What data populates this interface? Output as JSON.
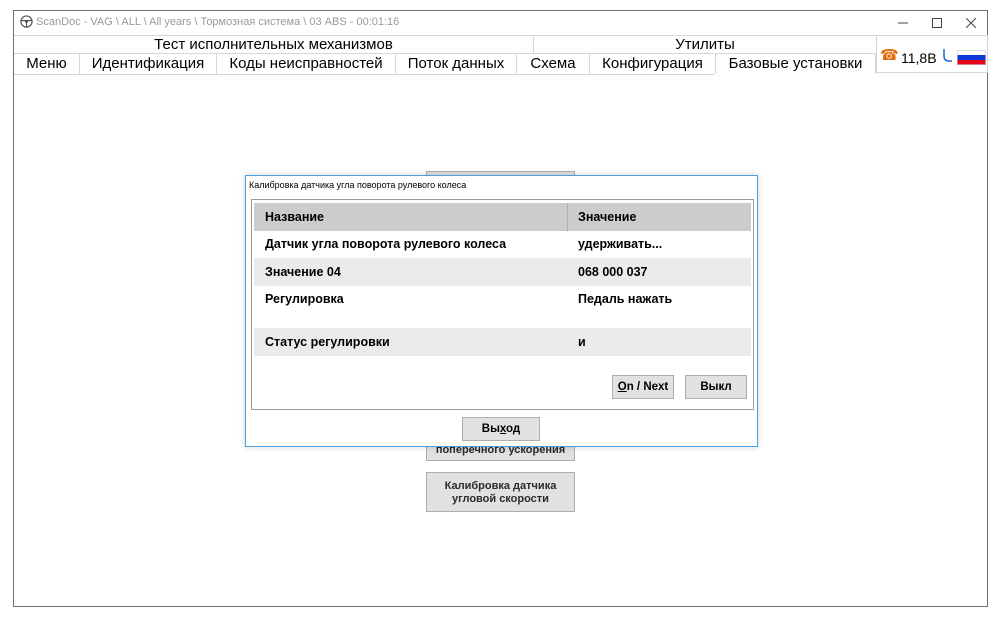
{
  "window": {
    "title": "ScanDoc - VAG \\ ALL \\ All years \\ Тормозная система \\ 03 ABS - 00:01:16",
    "controls": [
      "minimize-icon",
      "maximize-icon",
      "close-icon"
    ]
  },
  "groups": {
    "actuators": "Тест исполнительных механизмов",
    "utilities": "Утилиты"
  },
  "tabs": [
    {
      "label": "Меню"
    },
    {
      "label": "Идентификация"
    },
    {
      "label": "Коды неисправностей"
    },
    {
      "label": "Поток данных"
    },
    {
      "label": "Схема"
    },
    {
      "label": "Конфигурация"
    },
    {
      "label": "Базовые установки",
      "active": true
    }
  ],
  "status": {
    "voltage": "11,8В",
    "icons": [
      "phone-icon",
      "plug-icon",
      "russia-flag-icon"
    ],
    "phone_color": "#e36c0a"
  },
  "background_buttons": {
    "lateral_accel": "поперечного ускорения",
    "yaw_rate_line1": "Калибровка датчика",
    "yaw_rate_line2": "угловой скорости"
  },
  "dialog": {
    "title": "Калибровка датчика угла поворота рулевого колеса",
    "columns": [
      "Название",
      "Значение"
    ],
    "rows": [
      {
        "name": "Датчик угла поворота рулевого колеса",
        "value": "удерживать..."
      },
      {
        "name": "Значение 04",
        "value": "068 000 037"
      },
      {
        "name": "Регулировка",
        "value": "Педаль нажать"
      },
      {
        "name": "Статус регулировки",
        "value": "и"
      }
    ],
    "buttons": {
      "on_next_first": "O",
      "on_next_rest": "n / Next",
      "off": "Выкл",
      "exit_pre": "Вы",
      "exit_under": "х",
      "exit_post": "од"
    },
    "border_color": "#4a9fe0",
    "header_color": "#cccccc",
    "alt_row_color": "#ebebeb"
  }
}
